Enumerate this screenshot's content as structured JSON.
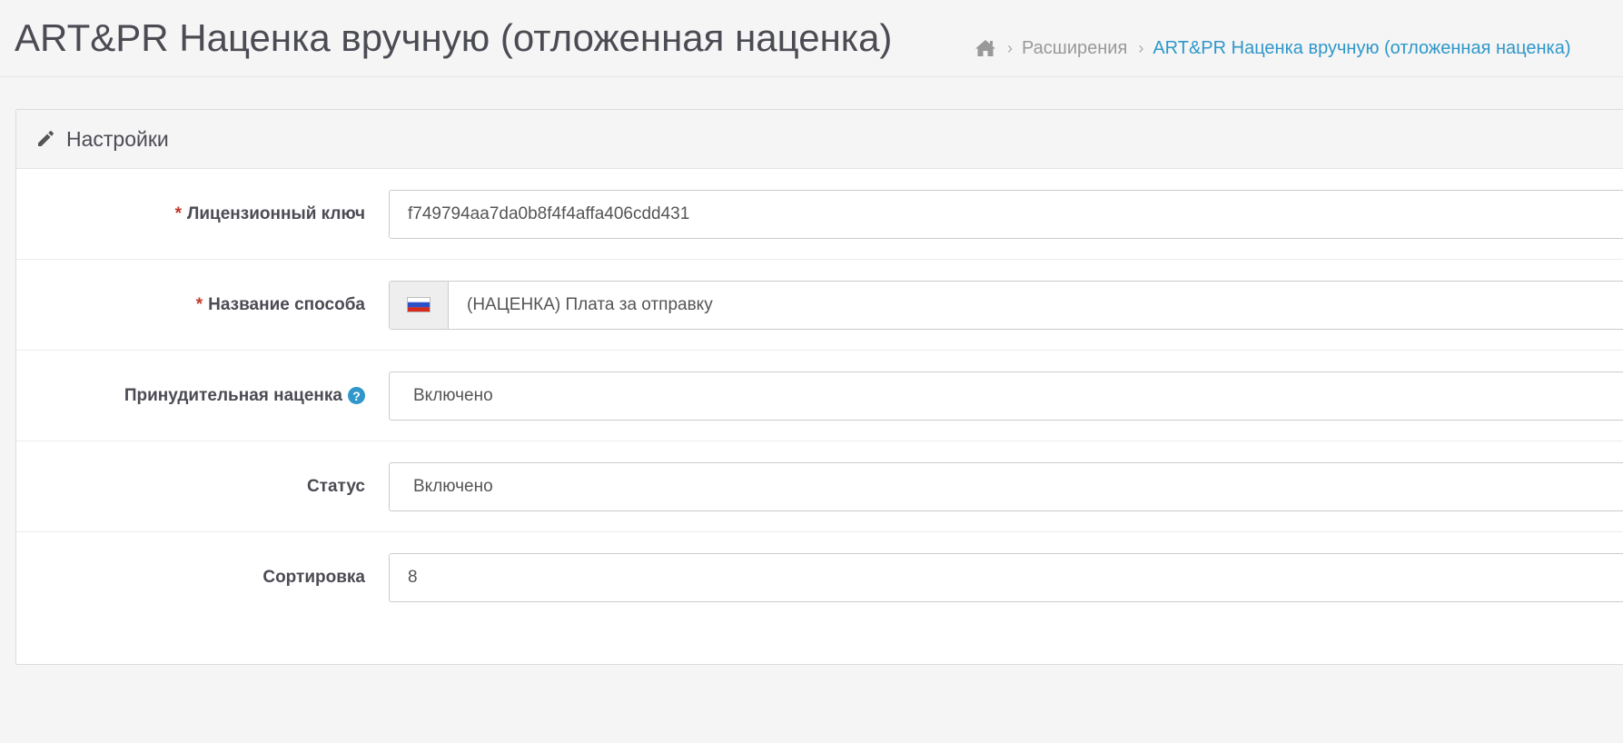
{
  "header": {
    "title": "ART&PR Наценка вручную (отложенная наценка)",
    "breadcrumb": [
      {
        "label": "Расширения"
      },
      {
        "label": "ART&PR Наценка вручную (отложенная наценка)"
      }
    ]
  },
  "panel": {
    "title": "Настройки"
  },
  "form": {
    "license_key": {
      "label": "Лицензионный ключ",
      "required": "*",
      "value": "f749794aa7da0b8f4f4affa406cdd431"
    },
    "method_name": {
      "label": "Название способа",
      "required": "*",
      "value": "(НАЦЕНКА) Плата за отправку"
    },
    "forced_markup": {
      "label": "Принудительная наценка",
      "help": "?",
      "value": "Включено"
    },
    "status": {
      "label": "Статус",
      "value": "Включено"
    },
    "sort_order": {
      "label": "Сортировка",
      "value": "8"
    }
  },
  "colors": {
    "accent": "#2f97c9",
    "required": "#c0392b",
    "title": "#4b4b54"
  },
  "icons": {
    "home": "home-icon",
    "pencil": "pencil-icon",
    "help": "question-circle-icon",
    "flag": "russia-flag-icon"
  }
}
